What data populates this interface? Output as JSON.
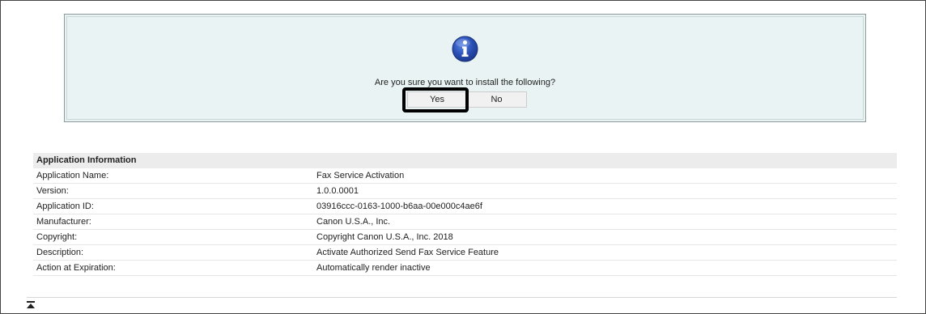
{
  "dialog": {
    "icon": "info-icon",
    "question": "Are you sure you want to install the following?",
    "yes_label": "Yes",
    "no_label": "No",
    "icon_color": "#2a4fb5",
    "background": "#e9f3f3"
  },
  "app_info": {
    "header": "Application Information",
    "rows": [
      {
        "label": "Application Name:",
        "value": "Fax Service Activation"
      },
      {
        "label": "Version:",
        "value": "1.0.0.0001"
      },
      {
        "label": "Application ID:",
        "value": "03916ccc-0163-1000-b6aa-00e000c4ae6f"
      },
      {
        "label": "Manufacturer:",
        "value": "Canon U.S.A., Inc."
      },
      {
        "label": "Copyright:",
        "value": "Copyright Canon U.S.A., Inc. 2018"
      },
      {
        "label": "Description:",
        "value": "Activate Authorized Send Fax Service Feature"
      },
      {
        "label": "Action at Expiration:",
        "value": "Automatically render inactive"
      }
    ]
  },
  "footer": {
    "icon": "scroll-to-top-icon"
  }
}
